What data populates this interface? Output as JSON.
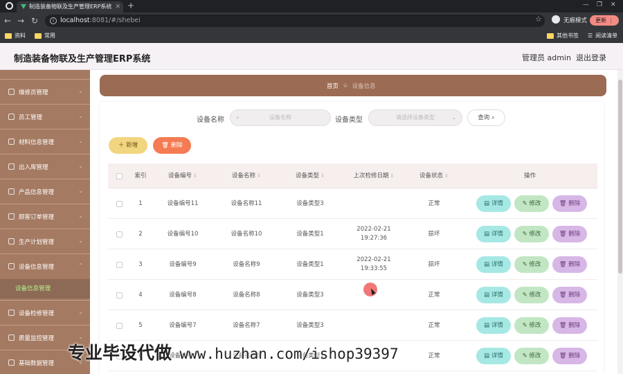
{
  "browser": {
    "tab_title": "制造装备物联及生产管理ERP系统",
    "url_host": "localhost",
    "url_path": ":8081/#/shebei",
    "incognito_label": "无痕模式",
    "update_label": "更新",
    "bookmarks": [
      "资料",
      "常用"
    ],
    "bookmarks_right": [
      "其他书签",
      "阅读清单"
    ]
  },
  "header": {
    "title": "制造装备物联及生产管理ERP系统",
    "admin": "管理员 admin",
    "logout": "退出登录"
  },
  "sidebar": {
    "items": [
      "维修员管理",
      "员工管理",
      "材料信息管理",
      "出入库管理",
      "产品信息管理",
      "顾客订单管理",
      "生产计划管理",
      "设备信息管理",
      "设备信息管理",
      "设备检修管理",
      "质量监控管理",
      "基础数据管理"
    ]
  },
  "breadcrumb": {
    "home": "首页",
    "current": "设备信息"
  },
  "search": {
    "name_label": "设备名称",
    "name_placeholder": "设备名称",
    "type_label": "设备类型",
    "type_placeholder": "请选择设备类型",
    "query_label": "查询"
  },
  "toolbar": {
    "add_label": "新增",
    "delete_label": "删除"
  },
  "table": {
    "headers": [
      "索引",
      "设备编号",
      "设备名称",
      "设备类型",
      "上次检修日期",
      "设备状态",
      "操作"
    ],
    "rows": [
      {
        "index": "1",
        "code": "设备编号11",
        "name": "设备名称11",
        "type": "设备类型3",
        "date": "",
        "status": "正常"
      },
      {
        "index": "2",
        "code": "设备编号10",
        "name": "设备名称10",
        "type": "设备类型1",
        "date": "2022-02-21 19:27:36",
        "status": "损坏"
      },
      {
        "index": "3",
        "code": "设备编号9",
        "name": "设备名称9",
        "type": "设备类型1",
        "date": "2022-02-21 19:33:55",
        "status": "损坏"
      },
      {
        "index": "4",
        "code": "设备编号8",
        "name": "设备名称8",
        "type": "设备类型3",
        "date": "",
        "status": "正常"
      },
      {
        "index": "5",
        "code": "设备编号7",
        "name": "设备名称7",
        "type": "设备类型3",
        "date": "",
        "status": "正常"
      },
      {
        "index": "6",
        "code": "设备编号6",
        "name": "设备名称6",
        "type": "设备类型1",
        "date": "",
        "status": "正常"
      }
    ],
    "actions": {
      "detail": "详情",
      "edit": "修改",
      "delete": "删除"
    }
  },
  "watermark": {
    "text": "专业毕设代做",
    "url": "www.huzhan.com/ishop39397"
  }
}
